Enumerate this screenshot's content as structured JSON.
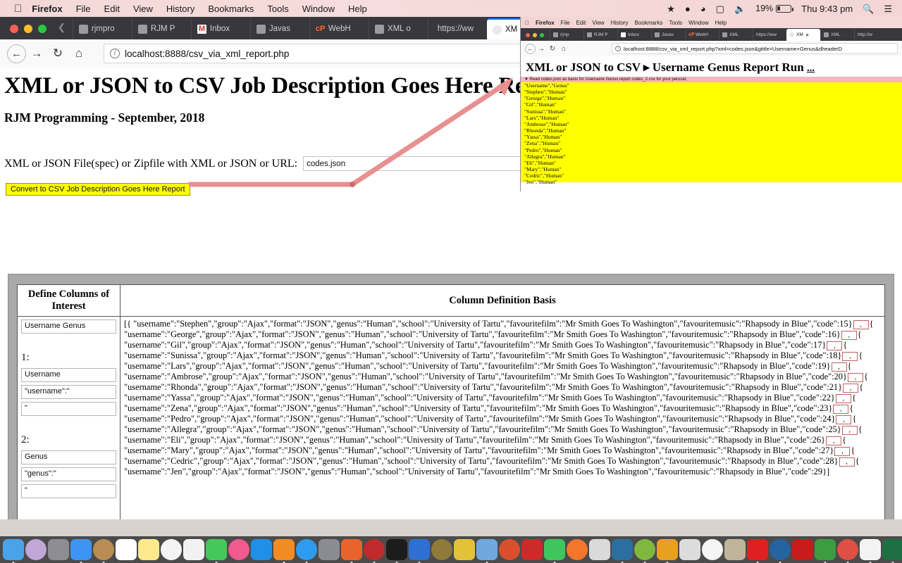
{
  "menubar": {
    "apple": "apple-logo",
    "items": [
      "Firefox",
      "File",
      "Edit",
      "View",
      "History",
      "Bookmarks",
      "Tools",
      "Window",
      "Help"
    ],
    "battery_percent": "19%",
    "clock": "Thu 9:43 pm",
    "status_icons": [
      "dropbox-icon",
      "record-icon",
      "wifi-icon",
      "airplay-icon",
      "volume-icon",
      "battery-icon",
      "search-icon",
      "notification-center-icon"
    ]
  },
  "browser": {
    "tabs": [
      {
        "label": "rjmpro",
        "favicon": "generic-favicon"
      },
      {
        "label": "RJM P",
        "favicon": "generic-favicon"
      },
      {
        "label": "Inbox",
        "favicon": "gmail-favicon"
      },
      {
        "label": "Javas",
        "favicon": "generic-favicon"
      },
      {
        "label": "WebH",
        "favicon": "cpanel-favicon"
      },
      {
        "label": "XML o",
        "favicon": "generic-favicon"
      },
      {
        "label": "https://ww",
        "favicon": "none"
      },
      {
        "label": "XM",
        "favicon": "globe-favicon",
        "active": true
      }
    ],
    "close_glyph": "✕",
    "nav": {
      "back": "←",
      "forward": "→",
      "reload": "↻",
      "home": "⌂"
    },
    "url": "localhost:8888/csv_via_xml_report.php"
  },
  "page": {
    "title": "XML or JSON to CSV Job Description Goes Here Report",
    "subtitle": "RJM Programming - September, 2018",
    "form": {
      "label": "XML or JSON File(spec) or Zipfile with XML or JSON or URL:",
      "file_value": "codes.json",
      "file_placeholder": "",
      "submit_label": "Convert to CSV Job Description Goes Here Report"
    },
    "table": {
      "header_left": "Define Columns of Interest",
      "header_right": "Column Definition Basis",
      "title_input": "Username Genus",
      "groups": [
        {
          "num": "1:",
          "name": "Username",
          "prefix": "\"username\":\"",
          "suffix": "\""
        },
        {
          "num": "2:",
          "name": "Genus",
          "prefix": "\"genus\":\"",
          "suffix": "\""
        }
      ],
      "json_open": "[{ \"username\":\"Stephen\",\"group\":\"Ajax\",\"format\":\"JSON\",\"genus\":\"Human\",\"school\":\"University of Tartu\",\"favouritefilm\":\"Mr Smith Goes To Washington\",\"favouritemusic\":\"Rhapsody in Blue\",\"code\":15}",
      "comma_glyph": ",",
      "records": [
        {
          "username": "George",
          "code": "16"
        },
        {
          "username": "Gil",
          "code": "17"
        },
        {
          "username": "Sunissa",
          "code": "18"
        },
        {
          "username": "Lars",
          "code": "19"
        },
        {
          "username": "Ambrose",
          "code": "20"
        },
        {
          "username": "Rhonda",
          "code": "21"
        },
        {
          "username": "Yassa",
          "code": "22"
        },
        {
          "username": "Zena",
          "code": "23"
        },
        {
          "username": "Pedro",
          "code": "24"
        },
        {
          "username": "Allegra",
          "code": "25"
        },
        {
          "username": "Eli",
          "code": "26"
        },
        {
          "username": "Mary",
          "code": "27"
        },
        {
          "username": "Cedric",
          "code": "28"
        },
        {
          "username": "Jen",
          "code": "29"
        }
      ],
      "record_fields": {
        "group": "Ajax",
        "format": "JSON",
        "genus": "Human",
        "school": "University of Tartu",
        "favouritefilm": "Mr Smith Goes To Washington",
        "favouritemusic": "Rhapsody in Blue"
      },
      "json_close": "]"
    }
  },
  "inner_window": {
    "menubar": {
      "items": [
        "Firefox",
        "File",
        "Edit",
        "View",
        "History",
        "Bookmarks",
        "Tools",
        "Window",
        "Help"
      ]
    },
    "tabs": [
      {
        "label": "rjmp",
        "favicon": "generic-favicon"
      },
      {
        "label": "RJM P",
        "favicon": "generic-favicon"
      },
      {
        "label": "Inbox",
        "favicon": "gmail-favicon"
      },
      {
        "label": "Javas",
        "favicon": "generic-favicon"
      },
      {
        "label": "WebH",
        "favicon": "cpanel-favicon"
      },
      {
        "label": "XML",
        "favicon": "generic-favicon"
      },
      {
        "label": "https://ww",
        "favicon": "none"
      },
      {
        "label": "XM",
        "favicon": "globe-favicon",
        "active": true
      },
      {
        "label": "XML",
        "favicon": "generic-favicon"
      },
      {
        "label": "http://w",
        "favicon": "none"
      }
    ],
    "close_glyph": "✕",
    "url": "localhost:8888/csv_via_xml_report.php?xml=codes.json&gtitle=Username+Genus&dheaderD",
    "heading": "XML or JSON to CSV ▸ Username Genus Report Run",
    "heading_dots": "...",
    "note": "▼ Read codes.json as basis for Username Genus report codes_2.csv for your perusal.",
    "csv_rows": [
      "\"Username\",\"Genus\"",
      "\"Stephen\",\"Human\"",
      "\"George\",\"Human\"",
      "\"Gil\",\"Human\"",
      "\"Sunissa\",\"Human\"",
      "\"Lars\",\"Human\"",
      "\"Ambrose\",\"Human\"",
      "\"Rhonda\",\"Human\"",
      "\"Yassa\",\"Human\"",
      "\"Zena\",\"Human\"",
      "\"Pedro\",\"Human\"",
      "\"Allegra\",\"Human\"",
      "\"Eli\",\"Human\"",
      "\"Mary\",\"Human\"",
      "\"Cedric\",\"Human\"",
      "\"Jen\",\"Human\""
    ]
  },
  "dock": {
    "apps": [
      {
        "name": "finder-icon",
        "color": "#4aa3e8"
      },
      {
        "name": "siri-icon",
        "color": "#c0a7d8"
      },
      {
        "name": "launchpad-icon",
        "color": "#8d8d93"
      },
      {
        "name": "safari-icon",
        "color": "#3d94f5"
      },
      {
        "name": "contacts-icon",
        "color": "#b88c52"
      },
      {
        "name": "calendar-icon",
        "color": "#ffffff"
      },
      {
        "name": "notes-icon",
        "color": "#fde88b"
      },
      {
        "name": "reminders-icon",
        "color": "#f4f4f4"
      },
      {
        "name": "photos-icon",
        "color": "#f2f2f2"
      },
      {
        "name": "messages-icon",
        "color": "#45c85a"
      },
      {
        "name": "itunes-icon",
        "color": "#f05a8c"
      },
      {
        "name": "app-store-icon",
        "color": "#1f8fe8"
      },
      {
        "name": "ibooks-icon",
        "color": "#f08c21"
      },
      {
        "name": "appstore-update-icon",
        "color": "#2d9cf0"
      },
      {
        "name": "system-preferences-icon",
        "color": "#8b8b92"
      },
      {
        "name": "firefox-icon",
        "color": "#e8642a"
      },
      {
        "name": "filezilla-icon",
        "color": "#bf2b2b"
      },
      {
        "name": "terminal-icon",
        "color": "#1c1c1c"
      },
      {
        "name": "xcode-icon",
        "color": "#2f6fd1"
      },
      {
        "name": "wireshark-icon",
        "color": "#8f7a3a"
      },
      {
        "name": "feather-icon",
        "color": "#e3c23a"
      },
      {
        "name": "preview-icon",
        "color": "#6fa8dc"
      },
      {
        "name": "vlc-icon",
        "color": "#d94f2b"
      },
      {
        "name": "quicktime-icon",
        "color": "#cf2a2a"
      },
      {
        "name": "whatsapp-icon",
        "color": "#3ec65c"
      },
      {
        "name": "avast-icon",
        "color": "#f4762a"
      },
      {
        "name": "inkscape-icon",
        "color": "#dadada"
      },
      {
        "name": "opera-q-icon",
        "color": "#2c6f9e"
      },
      {
        "name": "android-studio-icon",
        "color": "#7fb83e"
      },
      {
        "name": "android-studio-2-icon",
        "color": "#e8a020"
      },
      {
        "name": "globe-icon",
        "color": "#dcdcdc"
      },
      {
        "name": "document-icon",
        "color": "#f5f5f5"
      },
      {
        "name": "gimp-icon",
        "color": "#c0b49a"
      },
      {
        "name": "opera-icon",
        "color": "#e02020"
      },
      {
        "name": "vscode-icon",
        "color": "#2564a0"
      },
      {
        "name": "acrobat-icon",
        "color": "#c81b1b"
      },
      {
        "name": "chrome-dev-icon",
        "color": "#3d9c40"
      },
      {
        "name": "chrome-icon",
        "color": "#dd5044"
      },
      {
        "name": "pages-icon",
        "color": "#f3f3f3"
      },
      {
        "name": "excel-icon",
        "color": "#1d7044"
      }
    ],
    "minimized_windows": 7,
    "trash": "trash-icon"
  }
}
